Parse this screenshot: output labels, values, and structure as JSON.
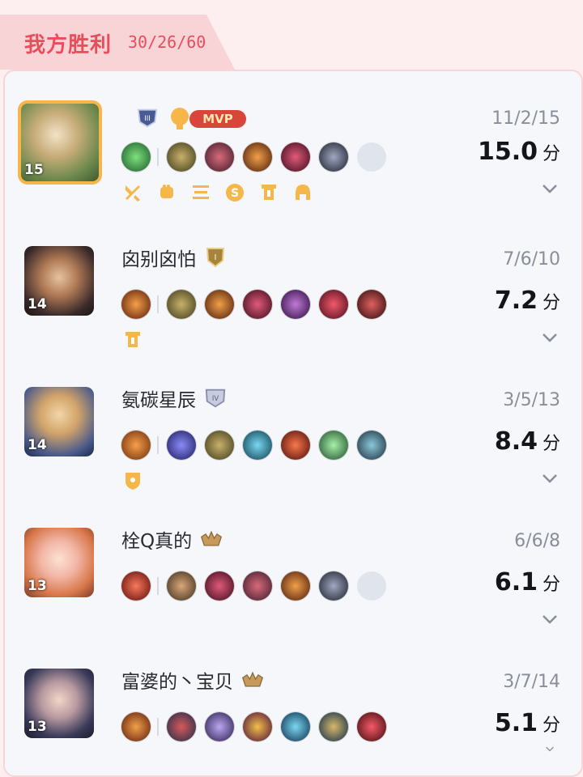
{
  "header": {
    "title": "我方胜利",
    "score": "30/26/60"
  },
  "colors": {
    "accent": "#e94d5c",
    "gold": "#f5b64a"
  },
  "players": [
    {
      "name": "",
      "level": "15",
      "rank_icon": "rank-iii-icon",
      "mvp": "MVP",
      "kda": "11/2/15",
      "score": "15.0",
      "unit": "分",
      "items": [
        "#2a8d3a",
        "#6b5a2a",
        "#8a2a3a",
        "#c0652a",
        "#a2283a",
        "#34384a",
        "empty"
      ],
      "badges": [
        "sword-icon",
        "fist-icon",
        "three-icon",
        "coin-icon",
        "tower-icon",
        "helmet-icon"
      ]
    },
    {
      "name": "囟别囟怕",
      "level": "14",
      "rank_icon": "rank-i-icon",
      "kda": "7/6/10",
      "score": "7.2",
      "unit": "分",
      "items": [
        "#a4482a",
        "#6b5a2a",
        "#b4582a",
        "#a82a4a",
        "#8a3a8a",
        "#b82a3a",
        "#8a2a2a"
      ],
      "badges": [
        "tower-icon"
      ]
    },
    {
      "name": "氨碳星辰",
      "level": "14",
      "rank_icon": "rank-iv-icon",
      "kda": "3/5/13",
      "score": "8.4",
      "unit": "分",
      "items": [
        "#c8582a",
        "#3a3ab4",
        "#6b5a2a",
        "#2a7a9a",
        "#a8382a",
        "#3a8a5a",
        "#2a5a6a"
      ],
      "badges": [
        "shield-icon"
      ]
    },
    {
      "name": "栓Q真的",
      "level": "13",
      "rank_icon": "rank-crown-icon",
      "kda": "6/6/8",
      "score": "6.1",
      "unit": "分",
      "items": [
        "#a8382a",
        "#7a5a3a",
        "#a82a4a",
        "#8a2a3a",
        "#c0652a",
        "#34384a",
        "empty"
      ],
      "badges": []
    },
    {
      "name": "富婆的丶宝贝",
      "level": "13",
      "rank_icon": "rank-crown-icon",
      "kda": "3/7/14",
      "score": "5.1",
      "unit": "分",
      "items": [
        "#a4482a",
        "#3a4a6a",
        "#5a3a8a",
        "#8a3a5a",
        "#2a6a8a",
        "#2a5a7a",
        "#a82a2a"
      ],
      "badges": []
    }
  ]
}
